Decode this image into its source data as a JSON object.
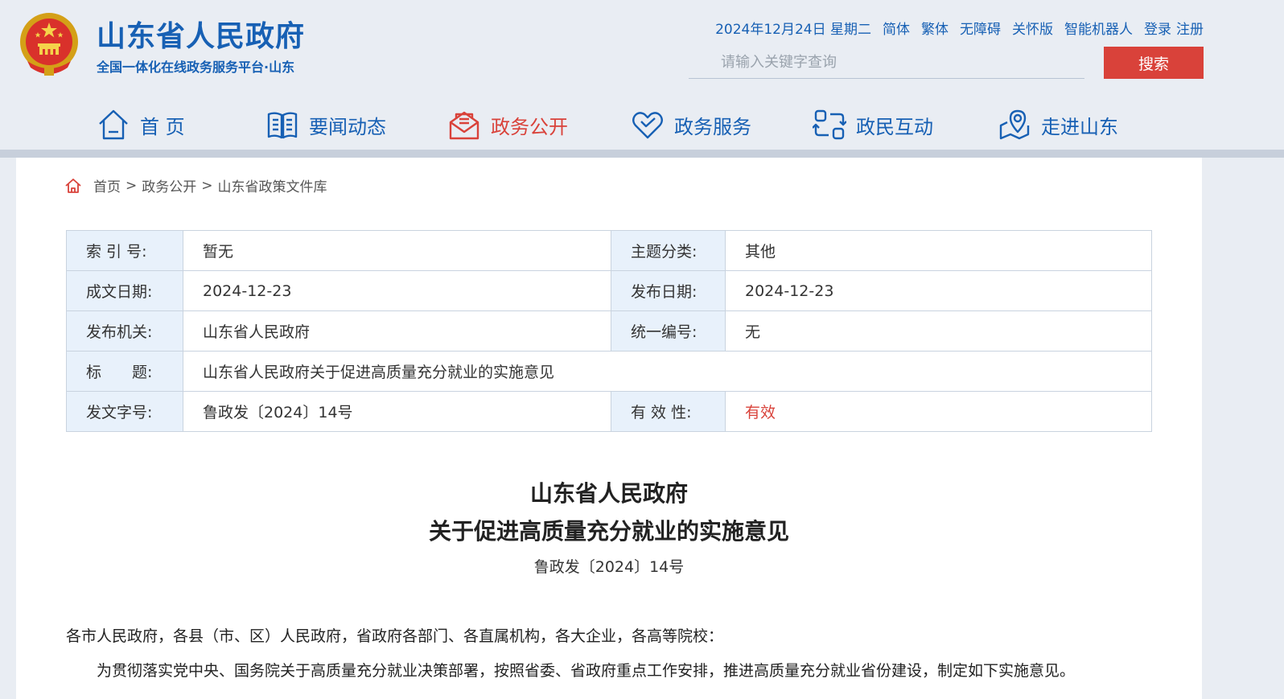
{
  "header": {
    "site_title": "山东省人民政府",
    "site_subtitle": "全国一体化在线政务服务平台·山东",
    "date": "2024年12月24日 星期二",
    "links": [
      "简体",
      "繁体",
      "无障碍",
      "关怀版",
      "智能机器人",
      "登录",
      "注册"
    ],
    "search_placeholder": "请输入关键字查询",
    "search_button": "搜索",
    "accent_color": "#1760b4",
    "highlight_color": "#d9423a"
  },
  "nav": {
    "items": [
      {
        "label": "首 页",
        "icon": "home-icon"
      },
      {
        "label": "要闻动态",
        "icon": "book-icon"
      },
      {
        "label": "政务公开",
        "icon": "mail-icon",
        "active": true
      },
      {
        "label": "政务服务",
        "icon": "heart-icon"
      },
      {
        "label": "政民互动",
        "icon": "interaction-icon"
      },
      {
        "label": "走进山东",
        "icon": "location-icon"
      }
    ]
  },
  "breadcrumb": {
    "items": [
      "首页",
      "政务公开",
      "山东省政策文件库"
    ],
    "separator": ">"
  },
  "meta": {
    "index_label": "索 引 号:",
    "index_value": "暂无",
    "topic_label": "主题分类:",
    "topic_value": "其他",
    "written_label": "成文日期:",
    "written_value": "2024-12-23",
    "published_label": "发布日期:",
    "published_value": "2024-12-23",
    "issuer_label": "发布机关:",
    "issuer_value": "山东省人民政府",
    "unified_label": "统一编号:",
    "unified_value": "无",
    "title_label": "标　　题:",
    "title_value": "山东省人民政府关于促进高质量充分就业的实施意见",
    "docno_label": "发文字号:",
    "docno_value": "鲁政发〔2024〕14号",
    "validity_label": "有 效 性:",
    "validity_value": "有效"
  },
  "document": {
    "title_line1": "山东省人民政府",
    "title_line2": "关于促进高质量充分就业的实施意见",
    "number": "鲁政发〔2024〕14号",
    "recipients": "各市人民政府，各县（市、区）人民政府，省政府各部门、各直属机构，各大企业，各高等院校：",
    "intro": "为贯彻落实党中央、国务院关于高质量充分就业决策部署，按照省委、省政府重点工作安排，推进高质量充分就业省份建设，制定如下实施意见。"
  }
}
